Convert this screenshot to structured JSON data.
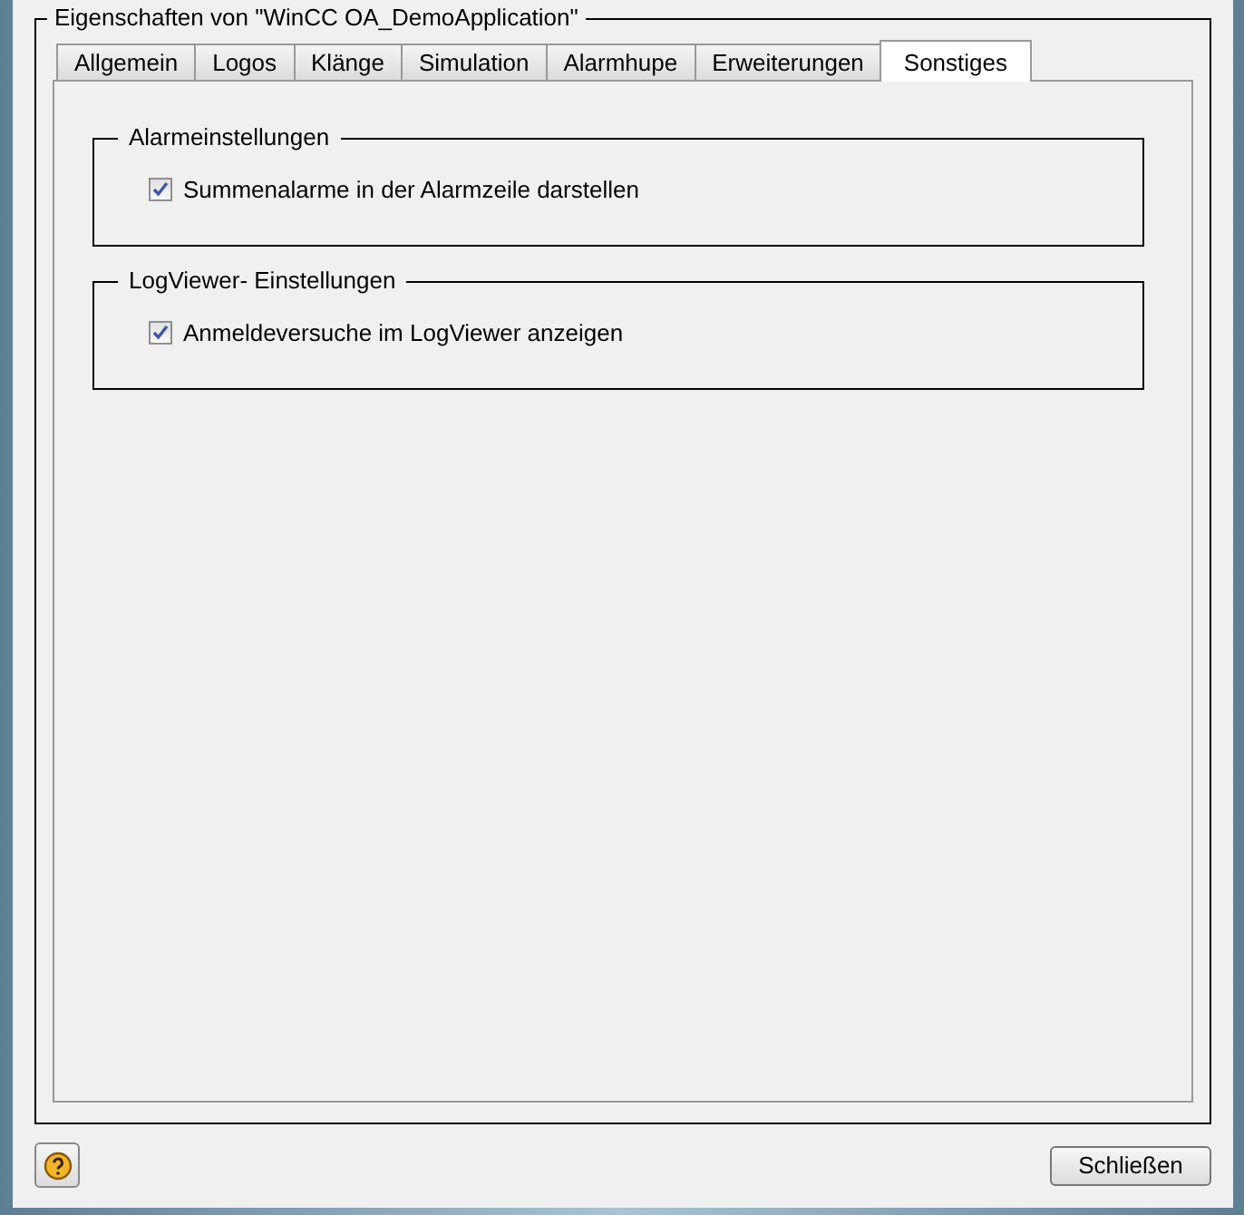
{
  "dialog": {
    "title": "Eigenschaften von \"WinCC OA_DemoApplication\""
  },
  "tabs": [
    {
      "label": "Allgemein",
      "selected": false
    },
    {
      "label": "Logos",
      "selected": false
    },
    {
      "label": "Klänge",
      "selected": false
    },
    {
      "label": "Simulation",
      "selected": false
    },
    {
      "label": "Alarmhupe",
      "selected": false
    },
    {
      "label": "Erweiterungen",
      "selected": false
    },
    {
      "label": "Sonstiges",
      "selected": true
    }
  ],
  "groups": [
    {
      "title": "Alarmeinstellungen",
      "options": [
        {
          "label": "Summenalarme in der Alarmzeile darstellen",
          "checked": true
        }
      ]
    },
    {
      "title": "LogViewer- Einstellungen",
      "options": [
        {
          "label": "Anmeldeversuche im LogViewer anzeigen",
          "checked": true
        }
      ]
    }
  ],
  "buttons": [
    {
      "label": "Schließen"
    }
  ]
}
